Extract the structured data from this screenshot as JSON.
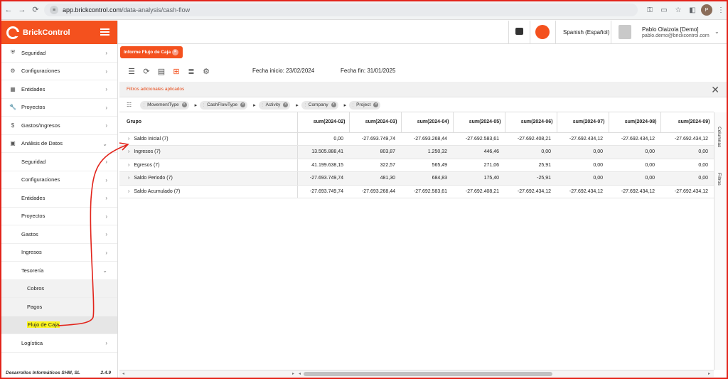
{
  "browser": {
    "url_host": "app.brickcontrol.com",
    "url_path": "/data-analysis/cash-flow",
    "profile_initial": "P"
  },
  "sidebar": {
    "brand": "BrickControl",
    "items": [
      {
        "label": "Seguridad",
        "icon": "shield-icon",
        "glyph": "⛨",
        "arrow": "›"
      },
      {
        "label": "Configuraciones",
        "icon": "gear-icon",
        "glyph": "⚙",
        "arrow": "›"
      },
      {
        "label": "Entidades",
        "icon": "building-icon",
        "glyph": "▦",
        "arrow": "›"
      },
      {
        "label": "Proyectos",
        "icon": "wrench-icon",
        "glyph": "🔧",
        "arrow": "›"
      },
      {
        "label": "Gastos/Ingresos",
        "icon": "dollar-icon",
        "glyph": "$",
        "arrow": "›"
      },
      {
        "label": "Análisis de Datos",
        "icon": "data-icon",
        "glyph": "▣",
        "arrow": "⌄"
      }
    ],
    "sub_items": [
      {
        "label": "Seguridad",
        "arrow": "›"
      },
      {
        "label": "Configuraciones",
        "arrow": "›"
      },
      {
        "label": "Entidades",
        "arrow": "›"
      },
      {
        "label": "Proyectos",
        "arrow": "›"
      },
      {
        "label": "Gastos",
        "arrow": "›"
      },
      {
        "label": "Ingresos",
        "arrow": "›"
      },
      {
        "label": "Tesorería",
        "arrow": "⌄"
      }
    ],
    "sub2_items": [
      {
        "label": "Cobros"
      },
      {
        "label": "Pagos"
      },
      {
        "label": "Flujo de Caja"
      }
    ],
    "after_items": [
      {
        "label": "Logística",
        "arrow": "›"
      }
    ],
    "footer_company": "Desarrollos Informáticos SHM, SL",
    "footer_version": "2.4.9"
  },
  "topbar": {
    "language": "Spanish (Español)",
    "user_name": "Pablo Olaizola [Demo]",
    "user_email": "pablo.demo@brickcontrol.com"
  },
  "tab": {
    "label": "Informe Flujo de Caja"
  },
  "dates": {
    "start": "Fecha inicio: 23/02/2024",
    "end": "Fecha fin: 31/01/2025"
  },
  "filters": {
    "label": "Filtros adicionales aplicados"
  },
  "pivot_chips": [
    "MovementType",
    "CashFlowType",
    "Activity",
    "Company",
    "Project"
  ],
  "grid": {
    "group_header": "Grupo",
    "columns": [
      "sum(2024-02)",
      "sum(2024-03)",
      "sum(2024-04)",
      "sum(2024-05)",
      "sum(2024-06)",
      "sum(2024-07)",
      "sum(2024-08)",
      "sum(2024-09)"
    ],
    "rows": [
      {
        "label": "Saldo Inicial (7)",
        "values": [
          "0,00",
          "-27.693.749,74",
          "-27.693.268,44",
          "-27.692.583,61",
          "-27.692.408,21",
          "-27.692.434,12",
          "-27.692.434,12",
          "-27.692.434,12"
        ]
      },
      {
        "label": "Ingresos (7)",
        "values": [
          "13.505.888,41",
          "803,87",
          "1.250,32",
          "446,46",
          "0,00",
          "0,00",
          "0,00",
          "0,00"
        ]
      },
      {
        "label": "Egresos (7)",
        "values": [
          "41.199.638,15",
          "322,57",
          "565,49",
          "271,06",
          "25,91",
          "0,00",
          "0,00",
          "0,00"
        ]
      },
      {
        "label": "Saldo Periodo (7)",
        "values": [
          "-27.693.749,74",
          "481,30",
          "684,83",
          "175,40",
          "-25,91",
          "0,00",
          "0,00",
          "0,00"
        ]
      },
      {
        "label": "Saldo Acumulado (7)",
        "values": [
          "-27.693.749,74",
          "-27.693.268,44",
          "-27.692.583,61",
          "-27.692.408,21",
          "-27.692.434,12",
          "-27.692.434,12",
          "-27.692.434,12",
          "-27.692.434,12"
        ]
      }
    ]
  },
  "side_panel": {
    "columns": "Columnas",
    "filters": "Filtros"
  },
  "colors": {
    "brand": "#f4511e",
    "annotation": "#e2231a",
    "highlight": "#fdf61e"
  }
}
